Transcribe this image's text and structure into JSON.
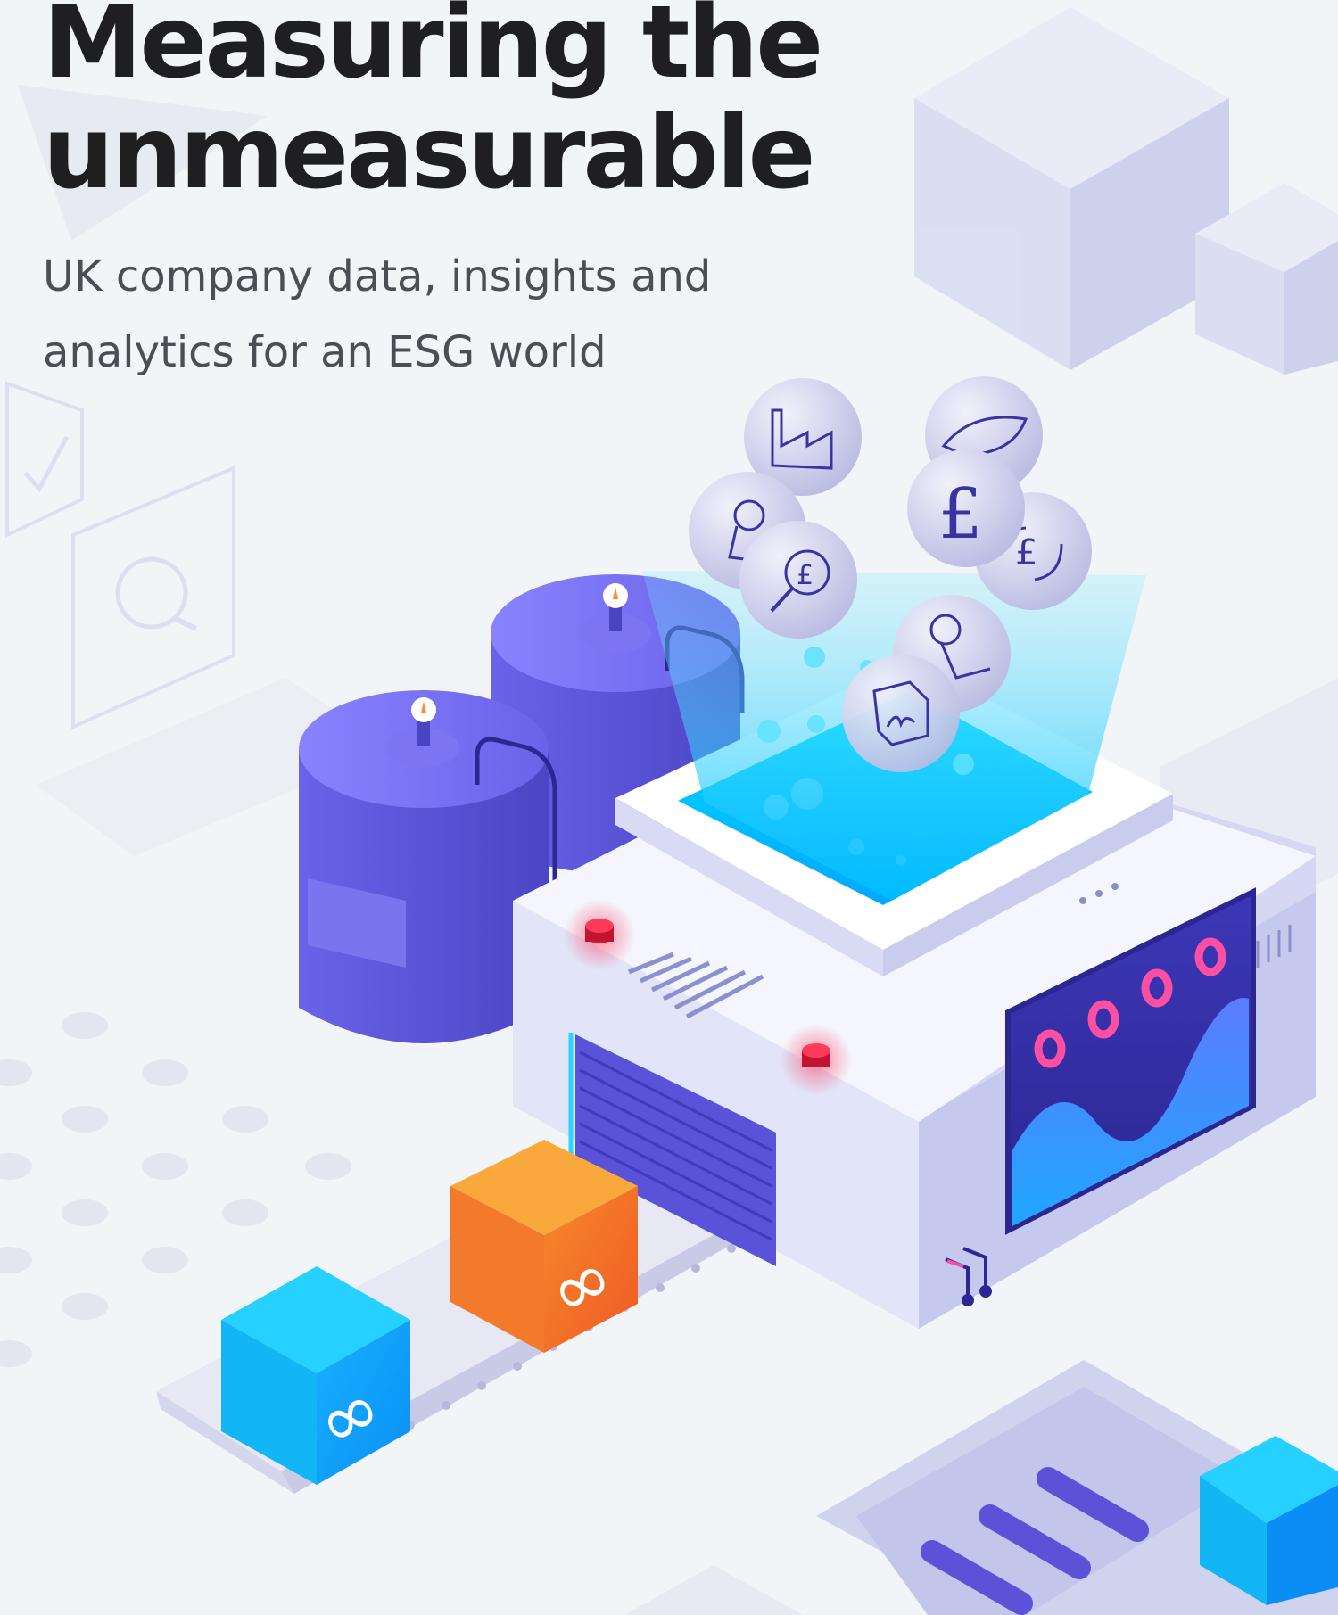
{
  "hero": {
    "title_line1": "Measuring the",
    "title_line2": "unmeasurable",
    "subtitle_line1": "UK company data, insights and",
    "subtitle_line2": "analytics for an ESG world"
  },
  "illustration": {
    "theme_colors": {
      "background": "#f2f5f7",
      "tank_purple": "#6b63e6",
      "machine_lavender": "#d8dbf5",
      "hopper_cyan": "#00c3ff",
      "box_orange": "#f37a2a",
      "box_blue": "#13b6f5",
      "indicator_red": "#e8193c",
      "screen_ring_pink": "#ff4fa3"
    },
    "symbol_bubbles": [
      {
        "icon": "factory-icon"
      },
      {
        "icon": "leaf-icon"
      },
      {
        "icon": "location-pin-icon"
      },
      {
        "icon": "pound-sign-icon"
      },
      {
        "icon": "pound-magnifier-icon"
      },
      {
        "icon": "currency-exchange-icon"
      },
      {
        "icon": "map-pin-path-icon"
      },
      {
        "icon": "signed-document-icon"
      }
    ],
    "box_icon": "infinity-icon",
    "display_rings": 4
  }
}
